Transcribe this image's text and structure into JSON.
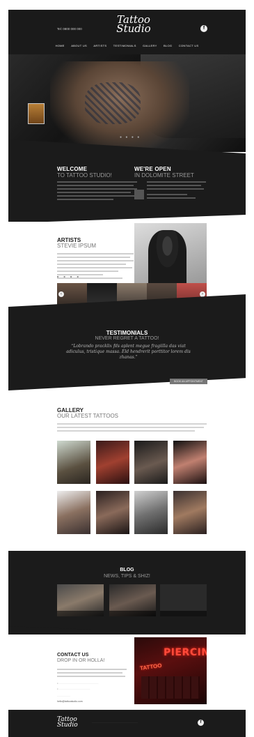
{
  "header": {
    "tel": "Tel: 0800 000 000",
    "logo_line1": "Tattoo",
    "logo_line2": "Studio",
    "facebook": "f",
    "nav": [
      "Home",
      "About us",
      "Artists",
      "Testimonials",
      "Gallery",
      "Blog",
      "Contact us"
    ]
  },
  "hero": {
    "dots": "● ● ● ●"
  },
  "welcome": {
    "title": "WELCOME",
    "subtitle": "TO TATTOO STUDIO!",
    "open_title": "WE'RE OPEN",
    "open_subtitle": "IN DOLOMITE STREET"
  },
  "artists": {
    "title": "ARTISTS",
    "subtitle": "STEVIE IPSUM",
    "social": "■ ■ ■ ■",
    "prev": "‹",
    "next": "›"
  },
  "testimonials": {
    "title": "TESTIMONIALS",
    "subtitle": "NEVER REGRET A TATTOO!",
    "quote": "“Lobrando pracklix fds aplent megue fragiilla das viat adiculus, tristique massa. Eld hendrerit porttitor lorem dis zhanas.”",
    "author": "",
    "button": "BOOK AN APPOINTMENT"
  },
  "gallery": {
    "title": "GALLERY",
    "subtitle": "OUR LATEST TATTOOS"
  },
  "blog": {
    "title": "BLOG",
    "subtitle": "NEWS, TIPS & SHIZ!"
  },
  "contact": {
    "title": "CONTACT US",
    "subtitle": "DROP IN OR HOLLA!",
    "email": "hello@tattoostudio.com",
    "neon_sign": "PIERCIN",
    "neon_sign2": "TATTOO"
  },
  "footer": {
    "logo_line1": "Tattoo",
    "logo_line2": "Studio",
    "facebook": "f"
  },
  "colors": {
    "dark": "#1b1b1b",
    "accent": "#777777"
  }
}
